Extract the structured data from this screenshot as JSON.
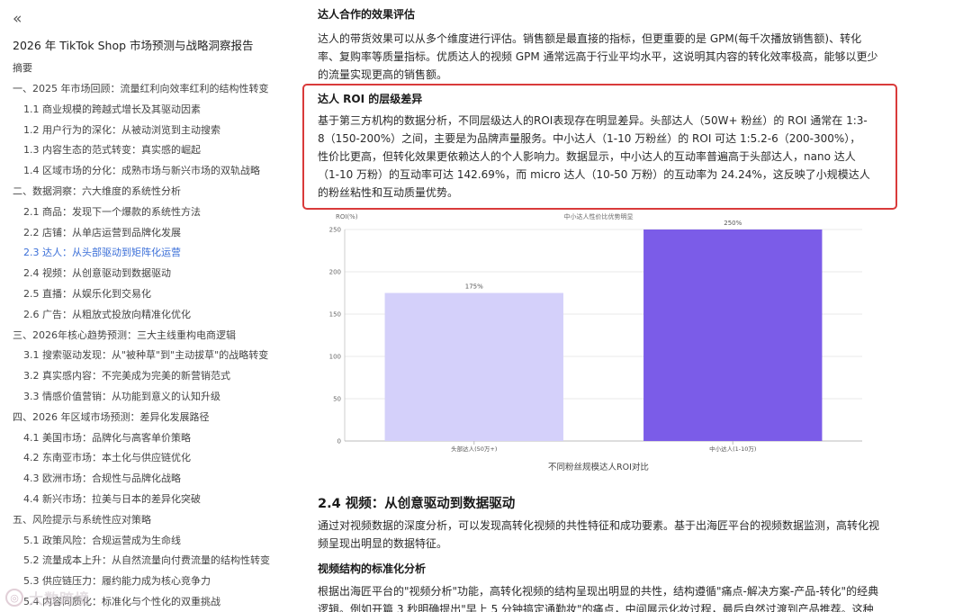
{
  "sidebar": {
    "collapse_icon": "«",
    "report_title": "2026 年 TikTok Shop 市场预测与战略洞察报告",
    "summary": "摘要",
    "items": [
      {
        "label": "一、2025 年市场回顾：流量红利向效率红利的结构性转变",
        "level": 1
      },
      {
        "label": "1.1 商业规模的跨越式增长及其驱动因素",
        "level": 2
      },
      {
        "label": "1.2 用户行为的深化：从被动浏览到主动搜索",
        "level": 2
      },
      {
        "label": "1.3 内容生态的范式转变：真实感的崛起",
        "level": 2
      },
      {
        "label": "1.4 区域市场的分化：成熟市场与新兴市场的双轨战略",
        "level": 2
      },
      {
        "label": "二、数据洞察：六大维度的系统性分析",
        "level": 1
      },
      {
        "label": "2.1 商品：发现下一个爆款的系统性方法",
        "level": 2
      },
      {
        "label": "2.2 店铺：从单店运营到品牌化发展",
        "level": 2
      },
      {
        "label": "2.3 达人：从头部驱动到矩阵化运营",
        "level": 2,
        "active": true
      },
      {
        "label": "2.4 视频：从创意驱动到数据驱动",
        "level": 2
      },
      {
        "label": "2.5 直播：从娱乐化到交易化",
        "level": 2
      },
      {
        "label": "2.6 广告：从粗放式投放向精准化优化",
        "level": 2
      },
      {
        "label": "三、2026年核心趋势预测：三大主线重构电商逻辑",
        "level": 1
      },
      {
        "label": "3.1 搜索驱动发现：从\"被种草\"到\"主动拔草\"的战略转变",
        "level": 2
      },
      {
        "label": "3.2 真实感内容：不完美成为完美的新营销范式",
        "level": 2
      },
      {
        "label": "3.3 情感价值营销：从功能到意义的认知升级",
        "level": 2
      },
      {
        "label": "四、2026 年区域市场预测：差异化发展路径",
        "level": 1
      },
      {
        "label": "4.1 美国市场：品牌化与高客单价策略",
        "level": 2
      },
      {
        "label": "4.2 东南亚市场：本土化与供应链优化",
        "level": 2
      },
      {
        "label": "4.3 欧洲市场：合规性与品牌化战略",
        "level": 2
      },
      {
        "label": "4.4 新兴市场：拉美与日本的差异化突破",
        "level": 2
      },
      {
        "label": "五、风险提示与系统性应对策略",
        "level": 1
      },
      {
        "label": "5.1 政策风险：合规运营成为生命线",
        "level": 2
      },
      {
        "label": "5.2 流量成本上升：从自然流量向付费流量的结构性转变",
        "level": 2
      },
      {
        "label": "5.3 供应链压力：履约能力成为核心竞争力",
        "level": 2
      },
      {
        "label": "5.4 内容同质化：标准化与个性化的双重挑战",
        "level": 2
      }
    ],
    "watermark": "大数跨境"
  },
  "main": {
    "h_effect": "达人合作的效果评估",
    "p_effect": "达人的带货效果可以从多个维度进行评估。销售额是最直接的指标，但更重要的是 GPM(每千次播放销售额)、转化率、复购率等质量指标。优质达人的视频 GPM 通常远高于行业平均水平，这说明其内容的转化效率极高，能够以更少的流量实现更高的销售额。",
    "h_roi": "达人 ROI 的层级差异",
    "p_roi": "基于第三方机构的数据分析，不同层级达人的ROI表现存在明显差异。头部达人（50W+ 粉丝）的 ROI 通常在 1:3-8（150-200%）之间，主要是为品牌声量服务。中小达人（1-10 万粉丝）的 ROI 可达 1:5.2-6（200-300%），性价比更高，但转化效果更依赖达人的个人影响力。数据显示，中小达人的互动率普遍高于头部达人，nano 达人（1-10 万粉）的互动率可达 142.69%，而 micro 达人（10-50 万粉）的互动率为 24.24%，这反映了小规模达人的粉丝粘性和互动质量优势。",
    "h_video": "2.4 视频：从创意驱动到数据驱动",
    "p_video": "通过对视频数据的深度分析，可以发现高转化视频的共性特征和成功要素。基于出海匠平台的视频数据监测，高转化视频呈现出明显的数据特征。",
    "h_structure": "视频结构的标准化分析",
    "p_structure": "根据出海匠平台的\"视频分析\"功能，高转化视频的结构呈现出明显的共性，结构遵循\"痛点-解决方案-产品-转化\"的经典逻辑。例如开篇 3 秒明确提出\"早上 5 分钟搞定通勤妆\"的痛点，中间展示化妆过程，最后自然过渡到产品推荐。这种结构能"
  },
  "chart_data": {
    "type": "bar",
    "title": "中小达人性价比优势明显",
    "ylabel": "ROI(%)",
    "xlabel": "不同粉丝规模达人ROI对比",
    "categories": [
      "头部达人(50万+)",
      "中小达人(1-10万)"
    ],
    "values": [
      175,
      250
    ],
    "value_labels": [
      "175%",
      "250%"
    ],
    "colors": [
      "#d4d0fa",
      "#7b5ce8"
    ],
    "ylim": [
      0,
      250
    ],
    "yticks": [
      0,
      50,
      100,
      150,
      200,
      250
    ],
    "grid": true
  }
}
